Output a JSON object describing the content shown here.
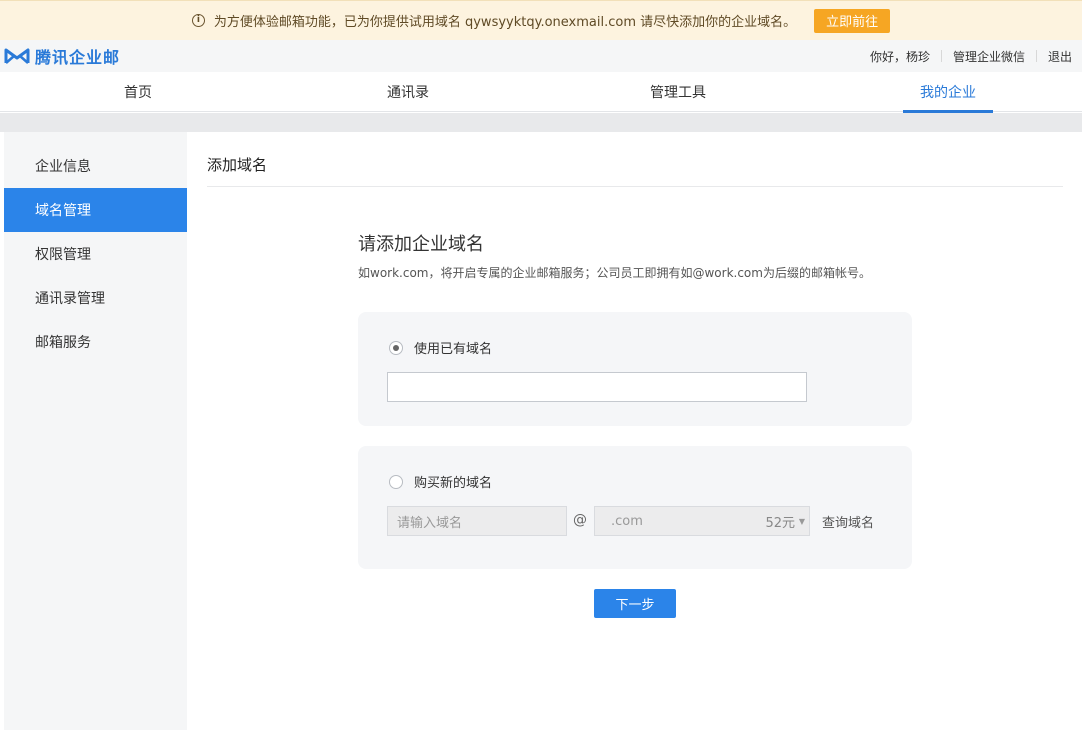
{
  "notice": {
    "text": "为方便体验邮箱功能，已为你提供试用域名 qywsyyktqy.onexmail.com 请尽快添加你的企业域名。",
    "icon": "info-icon",
    "button_label": "立即前往",
    "button_color": "#f6a623"
  },
  "header": {
    "logo_text": "腾讯企业邮",
    "greeting": "你好，杨珍",
    "links": [
      "管理企业微信",
      "退出"
    ]
  },
  "nav": {
    "tabs": [
      {
        "label": "首页",
        "active": false
      },
      {
        "label": "通讯录",
        "active": false
      },
      {
        "label": "管理工具",
        "active": false
      },
      {
        "label": "我的企业",
        "active": true
      }
    ]
  },
  "sidebar": {
    "items": [
      {
        "label": "企业信息",
        "active": false
      },
      {
        "label": "域名管理",
        "active": true
      },
      {
        "label": "权限管理",
        "active": false
      },
      {
        "label": "通讯录管理",
        "active": false
      },
      {
        "label": "邮箱服务",
        "active": false
      }
    ]
  },
  "main": {
    "title": "添加域名",
    "heading": "请添加企业域名",
    "description": "如work.com，将开启专属的企业邮箱服务；公司员工即拥有如@work.com为后缀的邮箱帐号。",
    "option_existing": {
      "label": "使用已有域名",
      "checked": true,
      "input_value": ""
    },
    "option_buy": {
      "label": "购买新的域名",
      "checked": false,
      "input_placeholder": "请输入域名",
      "at": "@",
      "suffix": ".com",
      "price": "52元",
      "query_label": "查询域名"
    },
    "next_label": "下一步"
  },
  "colors": {
    "accent": "#2b84e9",
    "notice_bg": "#fdf3df"
  }
}
